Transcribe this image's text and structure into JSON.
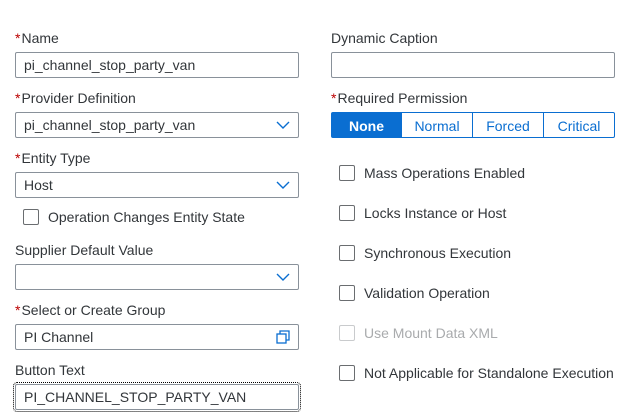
{
  "colors": {
    "accent": "#0a6ed1",
    "required": "#bb0000",
    "text": "#32363a",
    "border": "#89919a"
  },
  "form": {
    "name": {
      "required_mark": "*",
      "label": "Name",
      "value": "pi_channel_stop_party_van"
    },
    "provider_definition": {
      "required_mark": "*",
      "label": "Provider Definition",
      "value": "pi_channel_stop_party_van",
      "icon": "chevron-down-icon"
    },
    "entity_type": {
      "required_mark": "*",
      "label": "Entity Type",
      "value": "Host",
      "icon": "chevron-down-icon"
    },
    "operation_changes_entity_state": {
      "label": "Operation Changes Entity State",
      "checked": false
    },
    "supplier_default_value": {
      "label": "Supplier Default Value",
      "value": "",
      "icon": "chevron-down-icon"
    },
    "select_or_create_group": {
      "required_mark": "*",
      "label": "Select or Create Group",
      "value": "PI Channel",
      "icon": "value-help-icon"
    },
    "button_text": {
      "label": "Button Text",
      "value": "PI_CHANNEL_STOP_PARTY_VAN"
    },
    "dynamic_caption": {
      "label": "Dynamic Caption",
      "value": ""
    },
    "required_permission": {
      "required_mark": "*",
      "label": "Required Permission",
      "options": [
        "None",
        "Normal",
        "Forced",
        "Critical"
      ],
      "selected": "None"
    },
    "checkboxes": [
      {
        "label": "Mass Operations Enabled",
        "checked": false,
        "disabled": false
      },
      {
        "label": "Locks Instance or Host",
        "checked": false,
        "disabled": false
      },
      {
        "label": "Synchronous Execution",
        "checked": false,
        "disabled": false
      },
      {
        "label": "Validation Operation",
        "checked": false,
        "disabled": false
      },
      {
        "label": "Use Mount Data XML",
        "checked": false,
        "disabled": true
      },
      {
        "label": "Not Applicable for Standalone Execution",
        "checked": false,
        "disabled": false
      }
    ]
  }
}
